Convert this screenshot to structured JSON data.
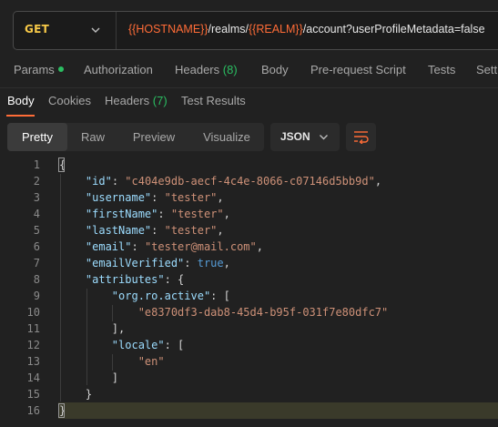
{
  "request": {
    "method": "GET",
    "url_parts": [
      {
        "text": "{{HOSTNAME}}",
        "var": true
      },
      {
        "text": "/realms/",
        "var": false
      },
      {
        "text": "{{REALM}}",
        "var": true
      },
      {
        "text": "/account?userProfileMetadata=false",
        "var": false
      }
    ]
  },
  "request_tabs": {
    "params": "Params",
    "authorization": "Authorization",
    "headers": "Headers",
    "headers_count": "(8)",
    "body": "Body",
    "prerequest": "Pre-request Script",
    "tests": "Tests",
    "settings": "Setti"
  },
  "response_tabs": {
    "body": "Body",
    "cookies": "Cookies",
    "headers": "Headers",
    "headers_count": "(7)",
    "test_results": "Test Results"
  },
  "view": {
    "pretty": "Pretty",
    "raw": "Raw",
    "preview": "Preview",
    "visualize": "Visualize",
    "format": "JSON"
  },
  "code": {
    "line_numbers": [
      "1",
      "2",
      "3",
      "4",
      "5",
      "6",
      "7",
      "8",
      "9",
      "10",
      "11",
      "12",
      "13",
      "14",
      "15",
      "16"
    ],
    "lines": [
      [
        {
          "t": "{",
          "c": "p"
        }
      ],
      [
        {
          "t": "    ",
          "c": "p"
        },
        {
          "t": "\"id\"",
          "c": "k"
        },
        {
          "t": ": ",
          "c": "p"
        },
        {
          "t": "\"c404e9db-aecf-4c4e-8066-c07146d5bb9d\"",
          "c": "s"
        },
        {
          "t": ",",
          "c": "p"
        }
      ],
      [
        {
          "t": "    ",
          "c": "p"
        },
        {
          "t": "\"username\"",
          "c": "k"
        },
        {
          "t": ": ",
          "c": "p"
        },
        {
          "t": "\"tester\"",
          "c": "s"
        },
        {
          "t": ",",
          "c": "p"
        }
      ],
      [
        {
          "t": "    ",
          "c": "p"
        },
        {
          "t": "\"firstName\"",
          "c": "k"
        },
        {
          "t": ": ",
          "c": "p"
        },
        {
          "t": "\"tester\"",
          "c": "s"
        },
        {
          "t": ",",
          "c": "p"
        }
      ],
      [
        {
          "t": "    ",
          "c": "p"
        },
        {
          "t": "\"lastName\"",
          "c": "k"
        },
        {
          "t": ": ",
          "c": "p"
        },
        {
          "t": "\"tester\"",
          "c": "s"
        },
        {
          "t": ",",
          "c": "p"
        }
      ],
      [
        {
          "t": "    ",
          "c": "p"
        },
        {
          "t": "\"email\"",
          "c": "k"
        },
        {
          "t": ": ",
          "c": "p"
        },
        {
          "t": "\"tester@mail.com\"",
          "c": "s"
        },
        {
          "t": ",",
          "c": "p"
        }
      ],
      [
        {
          "t": "    ",
          "c": "p"
        },
        {
          "t": "\"emailVerified\"",
          "c": "k"
        },
        {
          "t": ": ",
          "c": "p"
        },
        {
          "t": "true",
          "c": "b"
        },
        {
          "t": ",",
          "c": "p"
        }
      ],
      [
        {
          "t": "    ",
          "c": "p"
        },
        {
          "t": "\"attributes\"",
          "c": "k"
        },
        {
          "t": ": {",
          "c": "p"
        }
      ],
      [
        {
          "t": "        ",
          "c": "p"
        },
        {
          "t": "\"org.ro.active\"",
          "c": "k"
        },
        {
          "t": ": [",
          "c": "p"
        }
      ],
      [
        {
          "t": "            ",
          "c": "p"
        },
        {
          "t": "\"e8370df3-dab8-45d4-b95f-031f7e80dfc7\"",
          "c": "s"
        }
      ],
      [
        {
          "t": "        ],",
          "c": "p"
        }
      ],
      [
        {
          "t": "        ",
          "c": "p"
        },
        {
          "t": "\"locale\"",
          "c": "k"
        },
        {
          "t": ": [",
          "c": "p"
        }
      ],
      [
        {
          "t": "            ",
          "c": "p"
        },
        {
          "t": "\"en\"",
          "c": "s"
        }
      ],
      [
        {
          "t": "        ]",
          "c": "p"
        }
      ],
      [
        {
          "t": "    }",
          "c": "p"
        }
      ],
      [
        {
          "t": "}",
          "c": "p"
        }
      ]
    ]
  },
  "colors": {
    "accent": "#ff6c37",
    "method": "#f7c948",
    "success": "#2bbe62"
  }
}
